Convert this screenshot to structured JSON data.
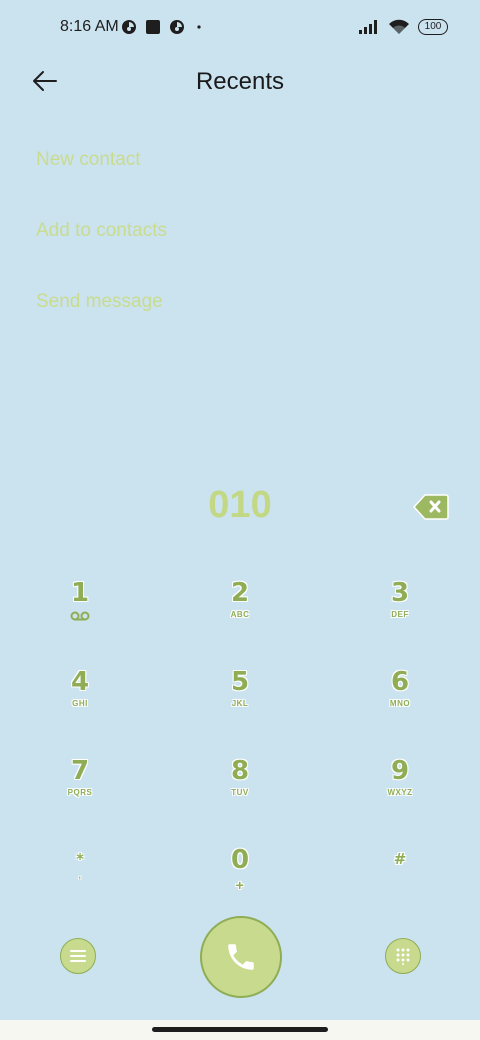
{
  "status_bar": {
    "time": "8:16 AM",
    "battery": "100",
    "icons_left": [
      "notification-app-icon",
      "stop-square-icon",
      "notification-app-icon",
      "more-dot-icon"
    ],
    "icons_right": [
      "signal-icon",
      "wifi-icon",
      "battery-icon"
    ]
  },
  "header": {
    "title": "Recents",
    "back_icon": "arrow-left-icon"
  },
  "actions": [
    {
      "label": "New contact"
    },
    {
      "label": "Add to contacts"
    },
    {
      "label": "Send message"
    }
  ],
  "dialer": {
    "number": "010",
    "backspace_icon": "backspace-icon"
  },
  "keypad": [
    {
      "digit": "1",
      "letters": "",
      "sub_icon": "voicemail-icon"
    },
    {
      "digit": "2",
      "letters": "ABC"
    },
    {
      "digit": "3",
      "letters": "DEF"
    },
    {
      "digit": "4",
      "letters": "GHI"
    },
    {
      "digit": "5",
      "letters": "JKL"
    },
    {
      "digit": "6",
      "letters": "MNO"
    },
    {
      "digit": "7",
      "letters": "PQRS"
    },
    {
      "digit": "8",
      "letters": "TUV"
    },
    {
      "digit": "9",
      "letters": "WXYZ"
    },
    {
      "digit": "*",
      "letters": ","
    },
    {
      "digit": "0",
      "letters": "+"
    },
    {
      "digit": "#",
      "letters": ""
    }
  ],
  "bottom": {
    "menu_icon": "menu-icon",
    "call_icon": "phone-icon",
    "dialpad_icon": "dialpad-icon"
  },
  "colors": {
    "background": "#cbe2ef",
    "accent_light": "#c8da8e",
    "accent_dark": "#8ead54",
    "action_text": "#c9dc8e"
  }
}
